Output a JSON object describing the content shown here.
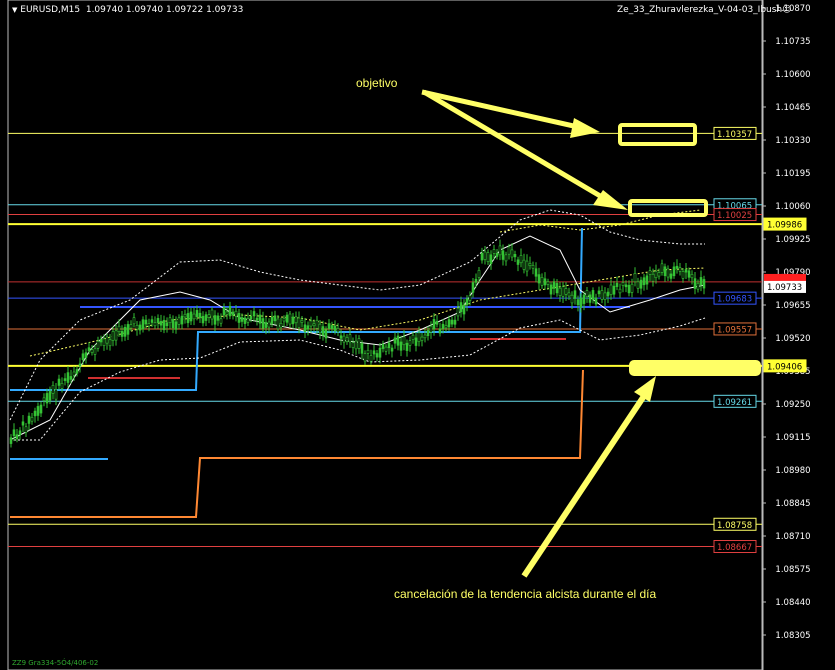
{
  "header": {
    "symbol": "EURUSD,M15",
    "ohlc": "1.09740 1.09740 1.09722 1.09733",
    "indicator": "Ze_33_Zhuravlerezka_V-04-03_Ibush"
  },
  "price_axis": {
    "labels": [
      "1.10870",
      "1.10735",
      "1.10600",
      "1.10465",
      "1.10330",
      "1.10195",
      "1.10060",
      "1.09925",
      "1.09790",
      "1.09655",
      "1.09520",
      "1.09385",
      "1.09250",
      "1.09115",
      "1.08980",
      "1.08845",
      "1.08710",
      "1.08575",
      "1.08440",
      "1.08305"
    ],
    "current_price": "1.09733"
  },
  "levels": [
    {
      "value": "1.10357",
      "color": "#ffff66"
    },
    {
      "value": "1.10065",
      "color": "#66d9e8"
    },
    {
      "value": "1.10025",
      "color": "#e04040"
    },
    {
      "value": "1.09986",
      "color": "#ffff33"
    },
    {
      "value": "1.09683",
      "color": "#3355ff"
    },
    {
      "value": "1.09557",
      "color": "#e0703a"
    },
    {
      "value": "1.09406",
      "color": "#ffff33"
    },
    {
      "value": "1.09261",
      "color": "#66d9e8"
    },
    {
      "value": "1.08758",
      "color": "#ffff66"
    },
    {
      "value": "1.08667",
      "color": "#e04040"
    }
  ],
  "annotations": {
    "target_label": "objetivo",
    "cancel_label": "cancelación de la tendencia alcista durante el día"
  },
  "footer": {
    "text": "ZZ9 Gra334-5Ó4/406-02"
  }
}
